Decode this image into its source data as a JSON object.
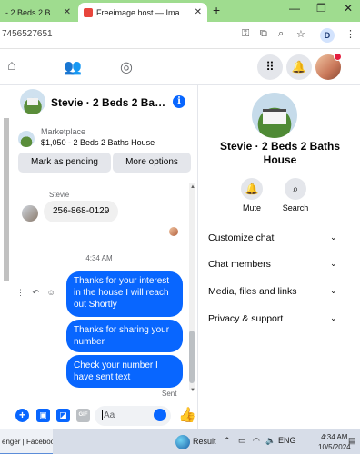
{
  "browser": {
    "tabs": [
      {
        "label": "- 2 Beds 2 Baths H"
      },
      {
        "label": "Freeimage.host — Image Hostin"
      }
    ],
    "new_tab": "+",
    "window_controls": {
      "minimize": "—",
      "maximize": "❐",
      "close": "✕"
    },
    "url": "7456527651",
    "profile_initial": "D"
  },
  "chat": {
    "title": "Stevie · 2 Beds 2 Bath...",
    "marketplace": {
      "label": "Marketplace",
      "item": "$1,050 - 2 Beds 2 Baths House",
      "primary_action": "Mark as pending",
      "secondary_action": "More options"
    },
    "sender_name": "Stevie",
    "incoming_message": "256-868-0129",
    "timestamp": "4:34 AM",
    "outgoing_messages": [
      "Thanks for your interest in the house I will reach out Shortly",
      "Thanks  for  sharing your number",
      "Check your number  I have  sent text"
    ],
    "status": "Sent",
    "composer_placeholder": "Aa"
  },
  "info_panel": {
    "name": "Stevie · 2 Beds 2 Baths House",
    "actions": [
      {
        "label": "Mute",
        "icon": "bell-icon"
      },
      {
        "label": "Search",
        "icon": "search-icon"
      }
    ],
    "sections": [
      "Customize chat",
      "Chat members",
      "Media, files and links",
      "Privacy & support"
    ]
  },
  "taskbar": {
    "app_label": "enger | Faceboo...",
    "widget_label": "Result",
    "language": "ENG",
    "time": "4:34 AM",
    "date": "10/5/2024"
  },
  "colors": {
    "messenger_blue": "#0866ff",
    "tab_strip": "#9fdc8f",
    "bubble_gray": "#f0f0f0"
  }
}
